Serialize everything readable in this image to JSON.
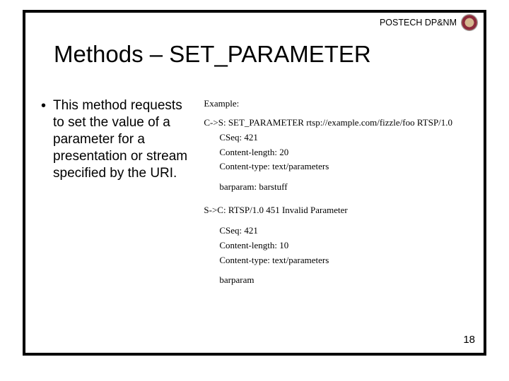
{
  "header": {
    "label": "POSTECH DP&NM",
    "logo_name": "postech-logo"
  },
  "title": "Methods – SET_PARAMETER",
  "bullet": {
    "mark": "•",
    "text": "This method requests to set the value of a parameter for a presentation or stream specified by the URI."
  },
  "example": {
    "label": "Example:",
    "request": {
      "line": "C->S:  SET_PARAMETER rtsp://example.com/fizzle/foo RTSP/1.0",
      "cseq": "CSeq: 421",
      "content_length": "Content-length: 20",
      "content_type": "Content-type: text/parameters",
      "body": "barparam: barstuff"
    },
    "response": {
      "line": "S->C:  RTSP/1.0 451 Invalid Parameter",
      "cseq": "CSeq: 421",
      "content_length": "Content-length: 10",
      "content_type": "Content-type: text/parameters",
      "body": "barparam"
    }
  },
  "page_number": "18"
}
